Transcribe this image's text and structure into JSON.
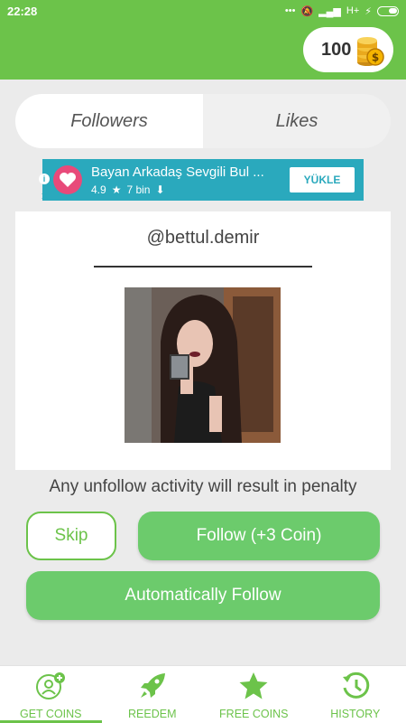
{
  "status_bar": {
    "time": "22:28",
    "network": "H+"
  },
  "coins": {
    "count": "100"
  },
  "tabs": [
    {
      "label": "Followers",
      "active": true
    },
    {
      "label": "Likes",
      "active": false
    }
  ],
  "ad": {
    "title": "Bayan Arkadaş Sevgili Bul ...",
    "rating": "4.9",
    "downloads": "7 bin",
    "button_label": "YÜKLE"
  },
  "profile": {
    "username": "@bettul.demir"
  },
  "warning_text": "Any unfollow activity will result in penalty",
  "buttons": {
    "skip": "Skip",
    "follow": "Follow (+3 Coin)",
    "auto_follow": "Automatically Follow"
  },
  "bottom_nav": [
    {
      "label": "GET COINS",
      "icon": "get-coins-icon",
      "active": true
    },
    {
      "label": "REEDEM",
      "icon": "rocket-icon",
      "active": false
    },
    {
      "label": "FREE COINS",
      "icon": "star-icon",
      "active": false
    },
    {
      "label": "HISTORY",
      "icon": "history-icon",
      "active": false
    }
  ],
  "colors": {
    "brand_green": "#6cc34a",
    "button_green": "#6ccb6c",
    "ad_teal": "#2aa9bd"
  }
}
